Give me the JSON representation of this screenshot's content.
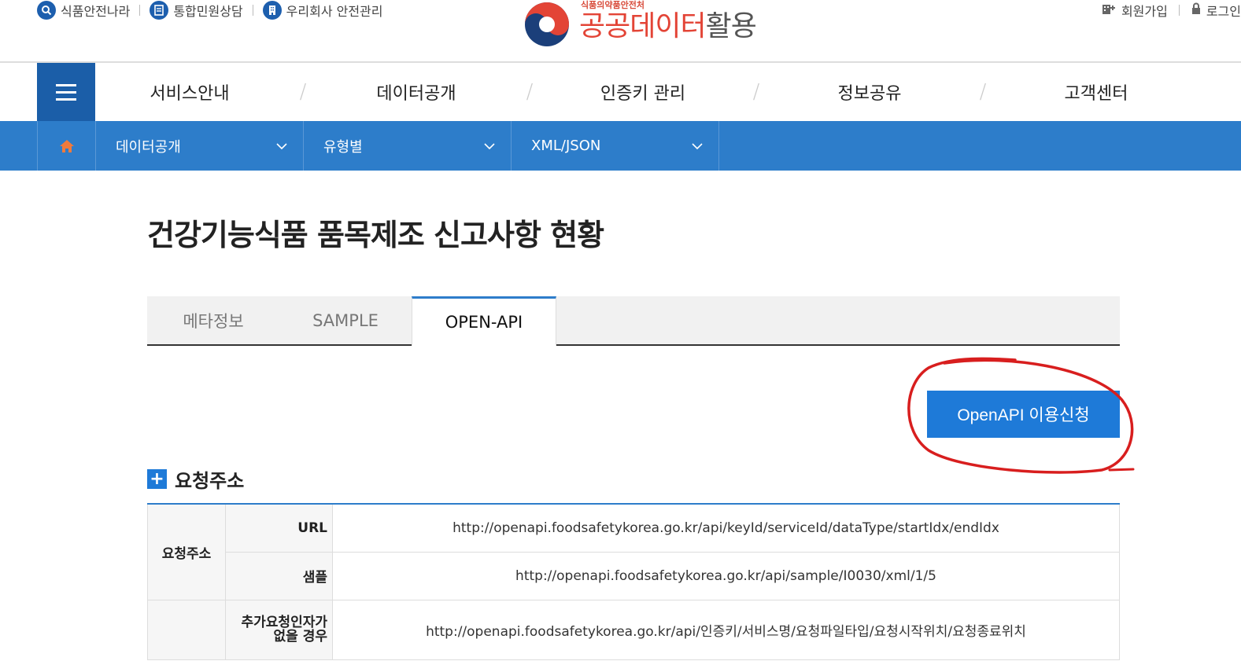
{
  "utility": {
    "left": [
      {
        "label": "식품안전나라",
        "icon": "search-icon"
      },
      {
        "label": "통합민원상담",
        "icon": "document-icon"
      },
      {
        "label": "우리회사 안전관리",
        "icon": "building-icon"
      }
    ],
    "right": [
      {
        "label": "회원가입",
        "icon": "add-user-icon"
      },
      {
        "label": "로그인",
        "icon": "lock-icon"
      }
    ]
  },
  "logo": {
    "sub": "식품의약품안전처",
    "main_part1": "공공",
    "main_part2": "데이터",
    "main_part3": "활용"
  },
  "gnb": {
    "items": [
      "서비스안내",
      "데이터공개",
      "인증키 관리",
      "정보공유",
      "고객센터"
    ],
    "separator": "/"
  },
  "location": {
    "level1": "데이터공개",
    "level2": "유형별",
    "level3": "XML/JSON"
  },
  "page": {
    "title": "건강기능식품 품목제조 신고사항 현황"
  },
  "tabs": [
    "메타정보",
    "SAMPLE",
    "OPEN-API"
  ],
  "apply_button": "OpenAPI 이용신청",
  "section": {
    "plus": "+",
    "title": "요청주소"
  },
  "table": {
    "category": "요청주소",
    "rows": [
      {
        "label": "URL",
        "value": "http://openapi.foodsafetykorea.go.kr/api/keyId/serviceId/dataType/startIdx/endIdx"
      },
      {
        "label": "샘플",
        "value": "http://openapi.foodsafetykorea.go.kr/api/sample/I0030/xml/1/5"
      },
      {
        "label_line1": "추가요청인자가",
        "label_line2": "없을 경우",
        "value": "http://openapi.foodsafetykorea.go.kr/api/인증키/서비스명/요청파일타입/요청시작위치/요청종료위치"
      }
    ]
  },
  "colors": {
    "primary_blue": "#1b5ea8",
    "location_blue": "#2d7dca",
    "button_blue": "#1e7ad8",
    "logo_red": "#e34436",
    "annotation_red": "#d81e1e"
  }
}
